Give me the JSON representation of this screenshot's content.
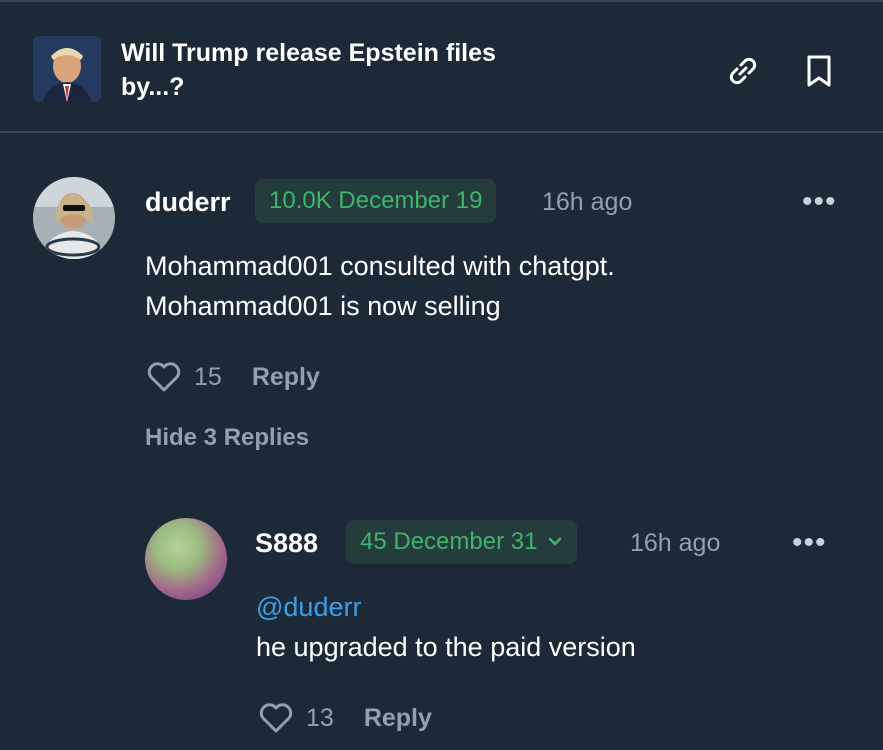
{
  "market": {
    "title": "Will Trump release Epstein files by...?",
    "thumbnail_icon": "market-thumbnail-icon",
    "link_icon": "link-icon",
    "bookmark_icon": "bookmark-icon"
  },
  "comment": {
    "username": "duderr",
    "position": "10.0K December 19",
    "time": "16h ago",
    "more": "•••",
    "text_line1": "Mohammad001 consulted with chatgpt.",
    "text_line2": "Mohammad001 is now selling",
    "likes": "15",
    "reply_label": "Reply",
    "hide_replies_label": "Hide 3 Replies"
  },
  "reply": {
    "username": "S888",
    "position": "45 December 31",
    "time": "16h ago",
    "more": "•••",
    "mention": "@duderr",
    "text": "he upgraded to the paid version",
    "likes": "13",
    "reply_label": "Reply"
  },
  "colors": {
    "background": "#1e2938",
    "badge_bg": "#243d3c",
    "badge_text": "#3fb36d",
    "muted": "#93a0ae",
    "mention": "#3a9fe8"
  }
}
